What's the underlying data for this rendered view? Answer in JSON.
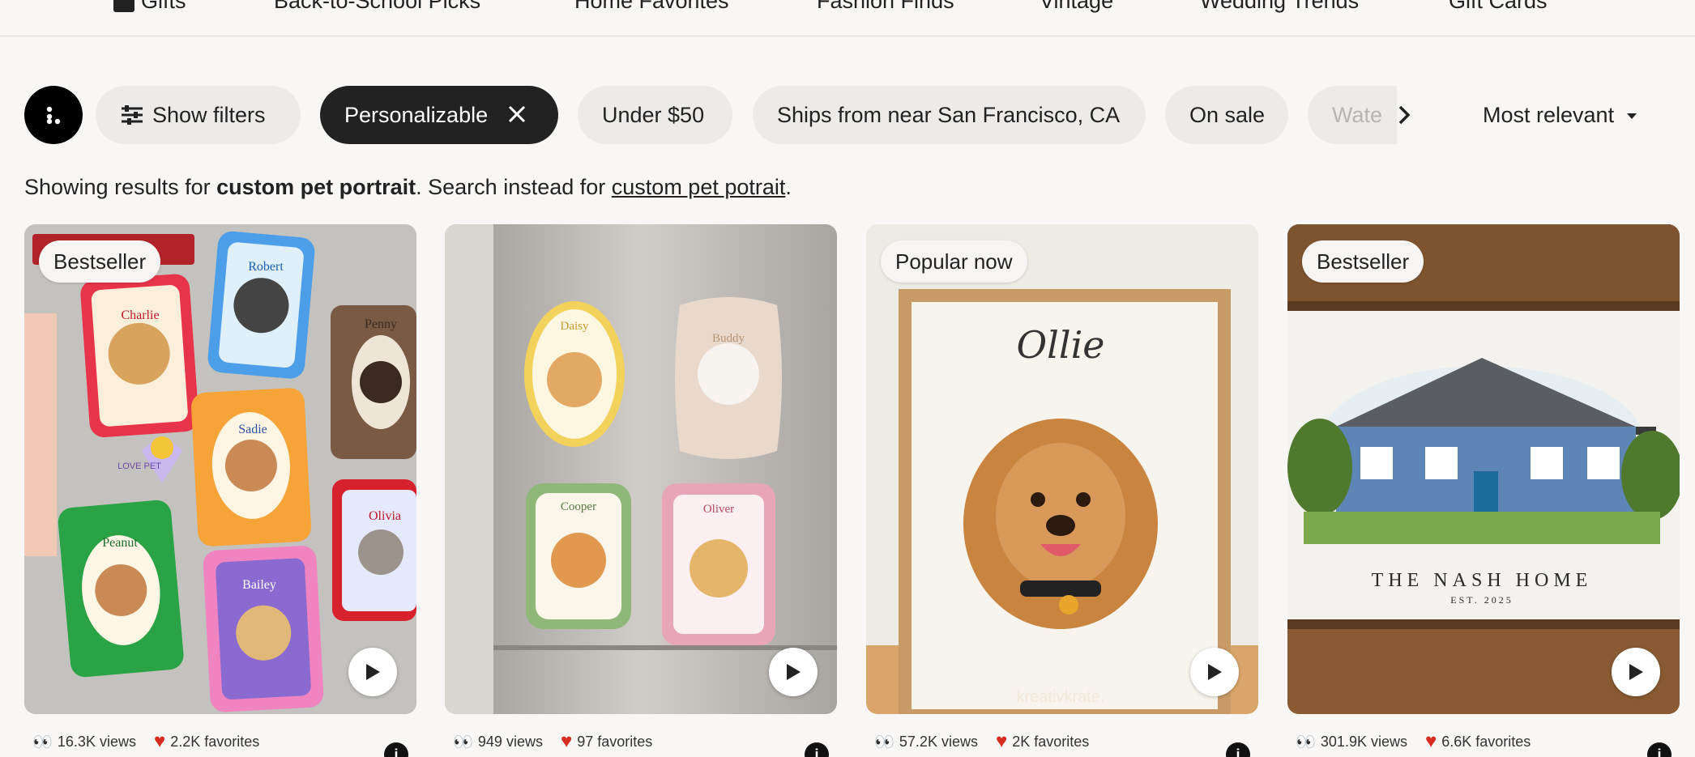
{
  "topnav": {
    "items": [
      "Gifts",
      "Back-to-School Picks",
      "Home Favorites",
      "Fashion Finds",
      "Vintage",
      "Wedding Trends",
      "Gift Cards"
    ]
  },
  "filters": {
    "show_filters": "Show filters",
    "chips": [
      "Personalizable",
      "Under $50",
      "Ships from near San Francisco, CA",
      "On sale",
      "Wate"
    ],
    "sort_label": "Most relevant"
  },
  "results": {
    "prefix": "Showing results for ",
    "query": "custom pet portrait",
    "middle": ". Search instead for ",
    "alt_query": "custom pet potrait",
    "suffix": "."
  },
  "cards": [
    {
      "badge": "Bestseller",
      "views": "16.3K views",
      "favorites": "2.2K favorites",
      "image_text": {
        "names": [
          "Charlie",
          "Robert",
          "Penny",
          "Sadie",
          "Peanut",
          "Bailey",
          "Olivia"
        ],
        "heart": "LOVE PET"
      }
    },
    {
      "badge": "",
      "views": "949 views",
      "favorites": "97 favorites",
      "image_text": {
        "names": [
          "Daisy",
          "Buddy",
          "Cooper",
          "Oliver"
        ]
      }
    },
    {
      "badge": "Popular now",
      "views": "57.2K views",
      "favorites": "2K favorites",
      "image_text": {
        "name": "Ollie",
        "watermark": "kreativkrate."
      }
    },
    {
      "badge": "Bestseller",
      "views": "301.9K views",
      "favorites": "6.6K favorites",
      "image_text": {
        "title": "THE NASH HOME",
        "est": "EST. 2025"
      }
    }
  ],
  "colors": {
    "background": "#f8f7f5",
    "chip": "#ecebe9",
    "chip_active": "#222222",
    "heart": "#d62d20"
  }
}
